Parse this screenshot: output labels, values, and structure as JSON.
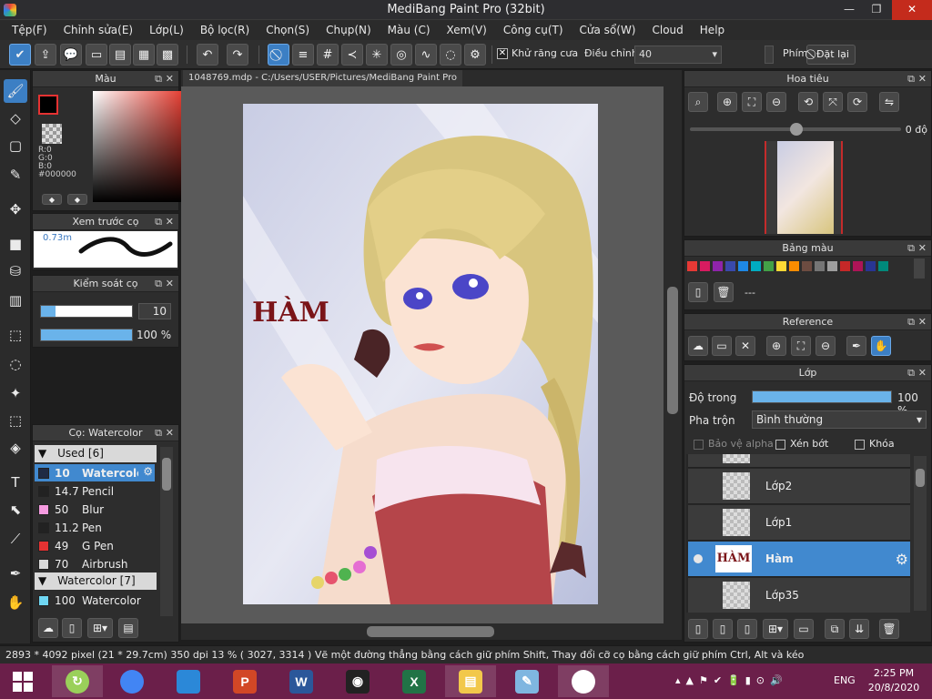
{
  "window": {
    "title": "MediBang Paint Pro (32bit)",
    "min_glyph": "—",
    "max_glyph": "❐",
    "close_glyph": "✕"
  },
  "menu": [
    "Tệp(F)",
    "Chỉnh sửa(E)",
    "Lớp(L)",
    "Bộ lọc(R)",
    "Chọn(S)",
    "Chụp(N)",
    "Màu (C)",
    "Xem(V)",
    "Công cụ(T)",
    "Cửa sổ(W)",
    "Cloud",
    "Help"
  ],
  "toolbar": {
    "antialias_label": "Khử răng cưa",
    "antialias_checked": "✕",
    "correction_label": "Điều chỉnh",
    "correction_value": "40",
    "hotkey_label": "Phím",
    "reset_label": "Đặt lại"
  },
  "color_panel": {
    "title": "Màu",
    "r": "R:0",
    "g": "G:0",
    "b": "B:0",
    "hex": "#000000",
    "foreground": "#000000"
  },
  "brush_preview": {
    "title": "Xem trước cọ",
    "size": "0.73m"
  },
  "brush_control": {
    "title": "Kiểm soát cọ",
    "size_value": "10",
    "size_fraction": 0.16,
    "opacity_value": "100 %",
    "opacity_fraction": 1.0
  },
  "brush_panel": {
    "title": "Cọ: Watercolor",
    "group_used": "Used [6]",
    "group_watercolor": "Watercolor [7]",
    "items": [
      {
        "size": "10",
        "name": "Watercolor",
        "color": "#1f2a44"
      },
      {
        "size": "14.7",
        "name": "Pencil",
        "color": "#222222"
      },
      {
        "size": "50",
        "name": "Blur",
        "color": "#f59be0"
      },
      {
        "size": "11.2",
        "name": "Pen",
        "color": "#222222"
      },
      {
        "size": "49",
        "name": "G Pen",
        "color": "#e53232"
      },
      {
        "size": "70",
        "name": "Airbrush",
        "color": "#d9d9d9"
      }
    ],
    "watercolor_item": {
      "size": "100",
      "name": "Watercolor",
      "color": "#6fd6f2"
    }
  },
  "document": {
    "tab": "1048769.mdp - C:/Users/USER/Pictures/MediBang Paint Pro",
    "canvas_text": "HÀM"
  },
  "navigator": {
    "title": "Hoa tiêu",
    "rotation": "0 độ"
  },
  "palette": {
    "title": "Bảng màu",
    "colors": [
      "#e53935",
      "#d81b60",
      "#8e24aa",
      "#3949ab",
      "#1e88e5",
      "#00acc1",
      "#43a047",
      "#fdd835",
      "#fb8c00",
      "#6d4c41",
      "#757575",
      "#9e9e9e",
      "#c62828",
      "#ad1457",
      "#283593",
      "#00897b"
    ],
    "empty": "---"
  },
  "reference": {
    "title": "Reference"
  },
  "layers": {
    "title": "Lớp",
    "opacity_label": "Độ trong",
    "opacity_value": "100 %",
    "opacity_fraction": 1.0,
    "blend_label": "Pha trộn",
    "blend_value": "Bình thường",
    "alpha_protect": "Bảo vệ alpha",
    "clip": "Xén bớt",
    "lock": "Khóa",
    "rows": [
      {
        "name": "Lớp2",
        "selected": false
      },
      {
        "name": "Lớp1",
        "selected": false
      },
      {
        "name": "Hàm",
        "selected": true
      },
      {
        "name": "Lớp35",
        "selected": false
      }
    ],
    "thumb_text": "HÀM"
  },
  "status": "2893 * 4092 pixel  (21 * 29.7cm)  350 dpi   13 %   ( 3027, 3314 )   Vẽ một đường thẳng bằng cách giữ phím Shift, Thay đổi cỡ cọ bằng cách giữ phím Ctrl, Alt và kéo",
  "taskbar": {
    "lang": "ENG",
    "time": "2:25 PM",
    "date": "20/8/2020",
    "apps": [
      {
        "name": "chrome-icon",
        "glyph": "",
        "color": "#4285f4"
      },
      {
        "name": "paint-icon",
        "glyph": "",
        "color": "#2b88d8"
      },
      {
        "name": "powerpoint-icon",
        "glyph": "P",
        "color": "#d24726"
      },
      {
        "name": "word-icon",
        "glyph": "W",
        "color": "#2b579a"
      },
      {
        "name": "camera-icon",
        "glyph": "◉",
        "color": "#222222"
      },
      {
        "name": "excel-icon",
        "glyph": "X",
        "color": "#217346"
      },
      {
        "name": "file-explorer-icon",
        "glyph": "▤",
        "color": "#f2c84b"
      },
      {
        "name": "notepad-icon",
        "glyph": "✎",
        "color": "#7fb6e0"
      },
      {
        "name": "medibang-icon",
        "glyph": "",
        "color": "#ffffff"
      }
    ]
  }
}
